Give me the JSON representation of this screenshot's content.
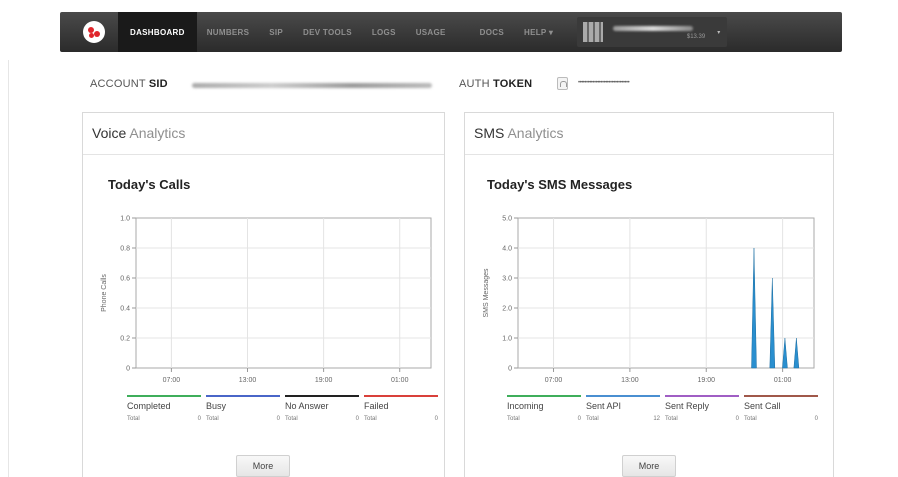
{
  "nav": {
    "items": [
      {
        "label": "DASHBOARD",
        "active": true
      },
      {
        "label": "NUMBERS",
        "active": false
      },
      {
        "label": "SIP",
        "active": false
      },
      {
        "label": "DEV TOOLS",
        "active": false
      },
      {
        "label": "LOGS",
        "active": false
      },
      {
        "label": "USAGE",
        "active": false
      },
      {
        "label": "DOCS",
        "active": false
      },
      {
        "label": "HELP ▾",
        "active": false
      }
    ],
    "account_balance": "$13.39",
    "account_caret": "▾"
  },
  "credentials": {
    "sid_label_light": "ACCOUNT",
    "sid_label_bold": "SID",
    "token_label_light": "AUTH",
    "token_label_bold": "TOKEN",
    "token_mask": "••••••••••••••••••••••••••••••••"
  },
  "voice": {
    "title_bold": "Voice",
    "title_light": "Analytics",
    "chart_title": "Today's Calls",
    "more_label": "More",
    "legend": [
      {
        "name": "Completed",
        "total_label": "Total",
        "total": "0",
        "color": "#3fae5b"
      },
      {
        "name": "Busy",
        "total_label": "Total",
        "total": "0",
        "color": "#4a66c8"
      },
      {
        "name": "No Answer",
        "total_label": "Total",
        "total": "0",
        "color": "#222222"
      },
      {
        "name": "Failed",
        "total_label": "Total",
        "total": "0",
        "color": "#d9403a"
      }
    ]
  },
  "sms": {
    "title_bold": "SMS",
    "title_light": "Analytics",
    "chart_title": "Today's SMS Messages",
    "more_label": "More",
    "legend": [
      {
        "name": "Incoming",
        "total_label": "Total",
        "total": "0",
        "color": "#3fae5b"
      },
      {
        "name": "Sent API",
        "total_label": "Total",
        "total": "12",
        "color": "#4a8fd1"
      },
      {
        "name": "Sent Reply",
        "total_label": "Total",
        "total": "0",
        "color": "#a05ec4"
      },
      {
        "name": "Sent Call",
        "total_label": "Total",
        "total": "0",
        "color": "#a0584a"
      }
    ]
  },
  "chart_data": [
    {
      "type": "line",
      "title": "Today's Calls",
      "ylabel": "Phone Calls",
      "xlabel": "",
      "x_ticks": [
        "07:00",
        "13:00",
        "19:00",
        "01:00"
      ],
      "y_ticks": [
        "0",
        "0.2",
        "0.4",
        "0.6",
        "0.8",
        "1.0"
      ],
      "ylim": [
        0,
        1.0
      ],
      "grid": true,
      "series": []
    },
    {
      "type": "area",
      "title": "Today's SMS Messages",
      "ylabel": "SMS Messages",
      "xlabel": "",
      "x_ticks": [
        "07:00",
        "13:00",
        "19:00",
        "01:00"
      ],
      "y_ticks": [
        "0",
        "1.0",
        "2.0",
        "3.0",
        "4.0",
        "5.0"
      ],
      "ylim": [
        0,
        5.0
      ],
      "grid": true,
      "series": [
        {
          "name": "Sent API",
          "color": "#2a8fcf",
          "spikes": [
            {
              "x_frac": 0.875,
              "value": 4.0
            },
            {
              "x_frac": 0.955,
              "value": 3.0
            },
            {
              "x_frac": 1.01,
              "value": 1.0
            },
            {
              "x_frac": 1.06,
              "value": 1.0
            }
          ]
        }
      ]
    }
  ]
}
